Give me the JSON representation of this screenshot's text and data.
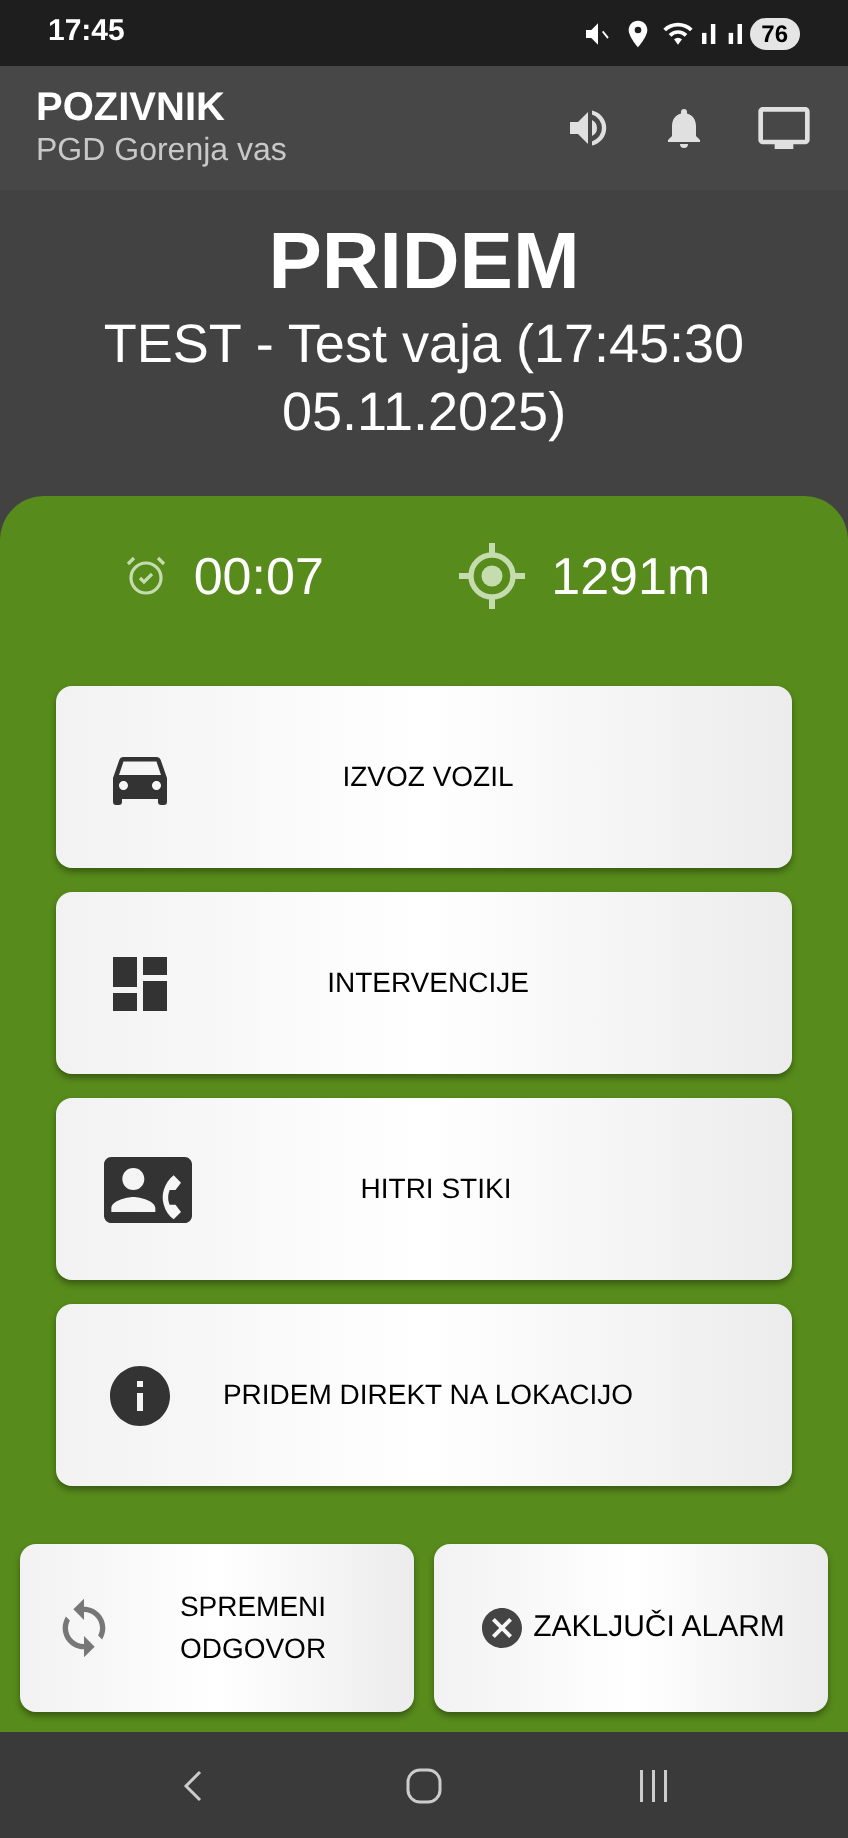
{
  "status_bar": {
    "time": "17:45",
    "battery": "76"
  },
  "app_bar": {
    "title": "POZIVNIK",
    "subtitle": "PGD Gorenja vas"
  },
  "alarm": {
    "response": "PRIDEM",
    "description": "TEST - Test vaja (17:45:30 05.11.2025)"
  },
  "stats": {
    "elapsed": "00:07",
    "distance": "1291m"
  },
  "actions": [
    {
      "kind": "car",
      "label": "IZVOZ VOZIL"
    },
    {
      "kind": "dashboard",
      "label": "INTERVENCIJE"
    },
    {
      "kind": "contacts",
      "label": "HITRI STIKI"
    },
    {
      "kind": "info",
      "label": "PRIDEM DIREKT NA LOKACIJO"
    }
  ],
  "bottom_buttons": [
    {
      "kind": "change",
      "label": "SPREMENI ODGOVOR"
    },
    {
      "kind": "close",
      "label": "ZAKLJUČI ALARM"
    }
  ]
}
